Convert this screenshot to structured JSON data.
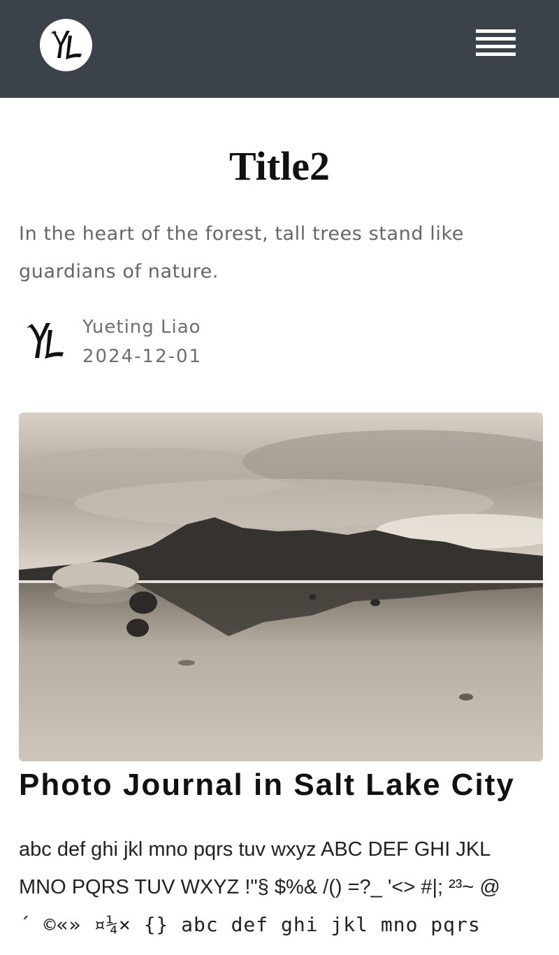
{
  "header": {
    "logo_initials": "YL",
    "menu_icon": "hamburger-menu-icon",
    "background": "#3b424a"
  },
  "article": {
    "title": "Title2",
    "subtitle": "In the heart of the forest, tall trees stand like guardians of nature.",
    "author": "Yueting Liao",
    "date": "2024-12-01",
    "photo_icon": "salt-lake-landscape-photo",
    "photo_heading": "Photo Journal in Salt Lake City",
    "body_line_1": "abc def ghi jkl mno pqrs tuv wxyz ABC DEF GHI JKL",
    "body_line_2": "MNO PQRS TUV WXYZ !\"§ $%& /() =?_ '<> #|; ²³~ @",
    "body_line_3": "´ ©«» ¤¼× {} abc def ghi jkl mno pqrs"
  }
}
